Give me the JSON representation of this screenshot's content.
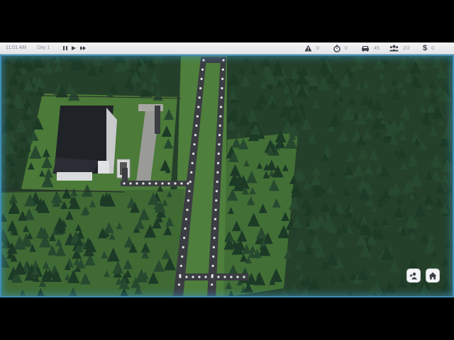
{
  "topbar": {
    "time": "11:01 AM",
    "day": "Day 1",
    "controls": {
      "pause_icon": "pause-icon",
      "play_icon": "play-icon",
      "fast_forward_icon": "fast-forward-icon"
    },
    "stats": [
      {
        "name": "alerts",
        "icon": "warning-icon",
        "value": "0"
      },
      {
        "name": "timer",
        "icon": "stopwatch-icon",
        "value": "0"
      },
      {
        "name": "vehicles",
        "icon": "car-icon",
        "value": "45"
      },
      {
        "name": "people",
        "icon": "people-icon",
        "value": "2/2"
      },
      {
        "name": "money",
        "icon": "dollar-icon",
        "value": "0"
      }
    ]
  },
  "hud_buttons": [
    {
      "name": "add-person-button",
      "icon": "add-person-icon"
    },
    {
      "name": "home-button",
      "icon": "home-icon"
    }
  ],
  "colors": {
    "grass": "#4a7a3a",
    "forest_dark": "#1e3a24",
    "road": "#3a3d42",
    "road_marker": "#e8e8e8",
    "frame_glow": "#3f8fb8",
    "building_roof": "#1f2226"
  }
}
